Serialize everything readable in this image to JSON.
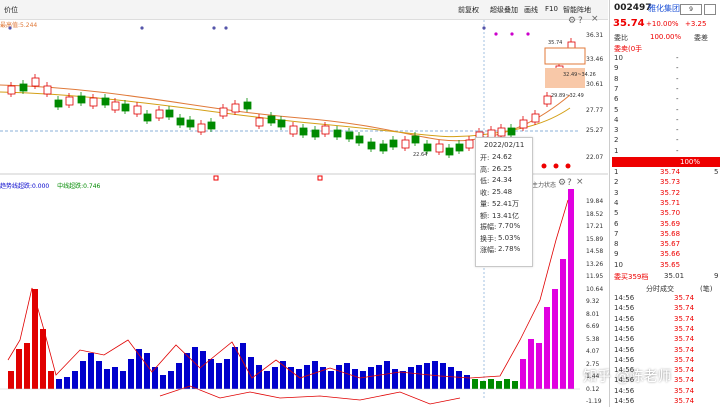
{
  "toolbar": {
    "left_label": "价位",
    "restore": "前复权",
    "overlay": "超级叠加",
    "draw": "画线",
    "f10": "F10",
    "smart": "智能阵地"
  },
  "main_label": "最高值:5.244",
  "stock": {
    "code": "002497",
    "name": "雅化集团",
    "period": "9",
    "price": "35.74",
    "pct": "+10.00%",
    "chg": "+3.25"
  },
  "orderbook": {
    "ratio_label": "委比",
    "ratio_value": "100.00%",
    "diff_label": "委差",
    "sell_total": "委卖(0手",
    "sell_rows": [
      {
        "l": "10",
        "p": "-"
      },
      {
        "l": "9",
        "p": "-"
      },
      {
        "l": "8",
        "p": "-"
      },
      {
        "l": "7",
        "p": "-"
      },
      {
        "l": "6",
        "p": "-"
      },
      {
        "l": "5",
        "p": "-"
      },
      {
        "l": "4",
        "p": "-"
      },
      {
        "l": "3",
        "p": "-"
      },
      {
        "l": "2",
        "p": "-"
      },
      {
        "l": "1",
        "p": "-"
      }
    ],
    "highlight": "100%",
    "buy_rows": [
      {
        "l": "1",
        "p": "35.74",
        "v": "5"
      },
      {
        "l": "2",
        "p": "35.73"
      },
      {
        "l": "3",
        "p": "35.72"
      },
      {
        "l": "4",
        "p": "35.71"
      },
      {
        "l": "5",
        "p": "35.70"
      },
      {
        "l": "6",
        "p": "35.69"
      },
      {
        "l": "7",
        "p": "35.68"
      },
      {
        "l": "8",
        "p": "35.67"
      },
      {
        "l": "9",
        "p": "35.66"
      },
      {
        "l": "10",
        "p": "35.65"
      }
    ],
    "buy_total": "委买359档",
    "buy_total_price": "35.01",
    "buy_total_v": "9"
  },
  "ticks": {
    "title": "分时成交",
    "unit": "(笔)",
    "rows": [
      {
        "t": "14:56",
        "p": "35.74"
      },
      {
        "t": "14:56",
        "p": "35.74"
      },
      {
        "t": "14:56",
        "p": "35.74"
      },
      {
        "t": "14:56",
        "p": "35.74"
      },
      {
        "t": "14:56",
        "p": "35.74"
      },
      {
        "t": "14:56",
        "p": "35.74"
      },
      {
        "t": "14:56",
        "p": "35.74"
      },
      {
        "t": "14:56",
        "p": "35.74"
      },
      {
        "t": "14:56",
        "p": "35.74"
      },
      {
        "t": "14:56",
        "p": "35.74"
      },
      {
        "t": "14:56",
        "p": "35.74"
      }
    ]
  },
  "tooltip": {
    "date": "2022/02/11",
    "rows": [
      {
        "k": "开:",
        "v": "24.62"
      },
      {
        "k": "高:",
        "v": "26.25"
      },
      {
        "k": "低:",
        "v": "24.34"
      },
      {
        "k": "收:",
        "v": "25.48"
      },
      {
        "k": "量:",
        "v": "52.41万"
      },
      {
        "k": "额:",
        "v": "13.41亿"
      },
      {
        "k": "振幅:",
        "v": "7.70%"
      },
      {
        "k": "换手:",
        "v": "5.03%"
      },
      {
        "k": "涨幅:",
        "v": "2.78%"
      }
    ]
  },
  "main_axis": [
    "36.31",
    "33.46",
    "30.61",
    "27.77",
    "25.27",
    "22.07"
  ],
  "sub_axis": [
    "19.84",
    "18.52",
    "17.21",
    "15.89",
    "14.58",
    "13.26",
    "11.95",
    "10.64",
    "9.32",
    "8.01",
    "6.69",
    "5.38",
    "4.07",
    "2.75",
    "1.44",
    "0.12",
    "-1.19"
  ],
  "annotations": {
    "high": "35.74",
    "zone1": "32.49~34.26",
    "zone2": "29.89~32.49",
    "low": "22.64"
  },
  "sub_label": {
    "a": "趋势线超跌:0.000",
    "b": "中线超跌:0.746"
  },
  "sub_title": "主力状态",
  "watermark": "知乎 @陈老师",
  "colors": {
    "up": "#e00000",
    "down": "#008a00",
    "blue": "#0000cc",
    "magenta": "#e000e0"
  }
}
